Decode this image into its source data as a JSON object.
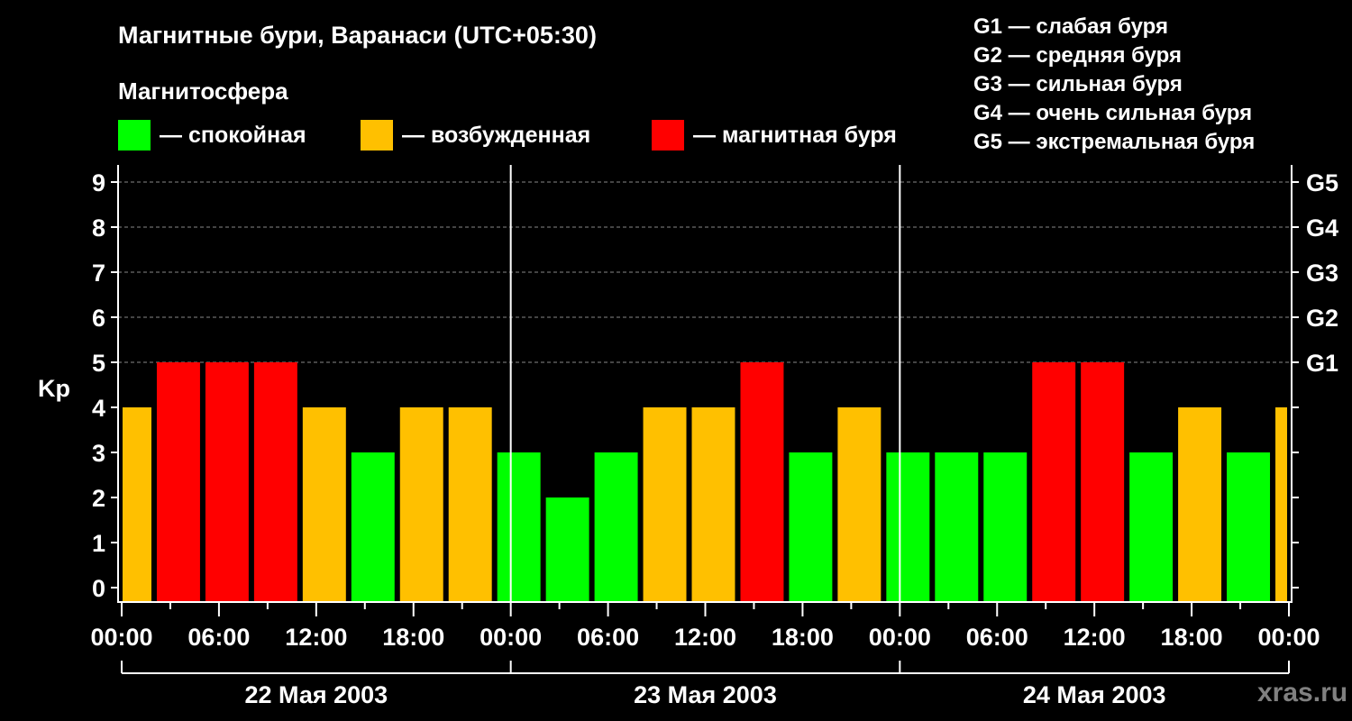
{
  "header": {
    "title": "Магнитные бури, Варанаси (UTC+05:30)",
    "subtitle": "Магнитосфера"
  },
  "legend": [
    {
      "label": "— спокойная",
      "color": "#00ff00"
    },
    {
      "label": "— возбужденная",
      "color": "#ffc000"
    },
    {
      "label": "— магнитная буря",
      "color": "#ff0000"
    }
  ],
  "g_scale": [
    "G1 — слабая буря",
    "G2 — средняя буря",
    "G3 — сильная буря",
    "G4 — очень сильная буря",
    "G5 — экстремальная буря"
  ],
  "credit": "xras.ru",
  "chart_data": {
    "type": "bar",
    "title": "Магнитные бури, Варанаси (UTC+05:30)",
    "ylabel": "Kp",
    "ylim": [
      0,
      9
    ],
    "yticks": [
      "0",
      "1",
      "2",
      "3",
      "4",
      "5",
      "6",
      "7",
      "8",
      "9"
    ],
    "right_ticks": [
      {
        "value": 5,
        "label": "G1"
      },
      {
        "value": 6,
        "label": "G2"
      },
      {
        "value": 7,
        "label": "G3"
      },
      {
        "value": 8,
        "label": "G4"
      },
      {
        "value": 9,
        "label": "G5"
      }
    ],
    "xlim_hours": [
      0,
      72
    ],
    "xticks": [
      "00:00",
      "06:00",
      "12:00",
      "18:00",
      "00:00",
      "06:00",
      "12:00",
      "18:00",
      "00:00",
      "06:00",
      "12:00",
      "18:00",
      "00:00"
    ],
    "days": [
      "22 Мая 2003",
      "23 Мая 2003",
      "24 Мая 2003"
    ],
    "bar_interval_hours": 3,
    "first_bar_start_hour": -1,
    "values": [
      4,
      5,
      5,
      5,
      4,
      3,
      4,
      4,
      3,
      2,
      3,
      4,
      4,
      5,
      3,
      4,
      3,
      3,
      3,
      5,
      5,
      3,
      4,
      3,
      4
    ],
    "colors": {
      "quiet": "#00ff00",
      "active": "#ffc000",
      "storm": "#ff0000"
    },
    "grid": true
  }
}
